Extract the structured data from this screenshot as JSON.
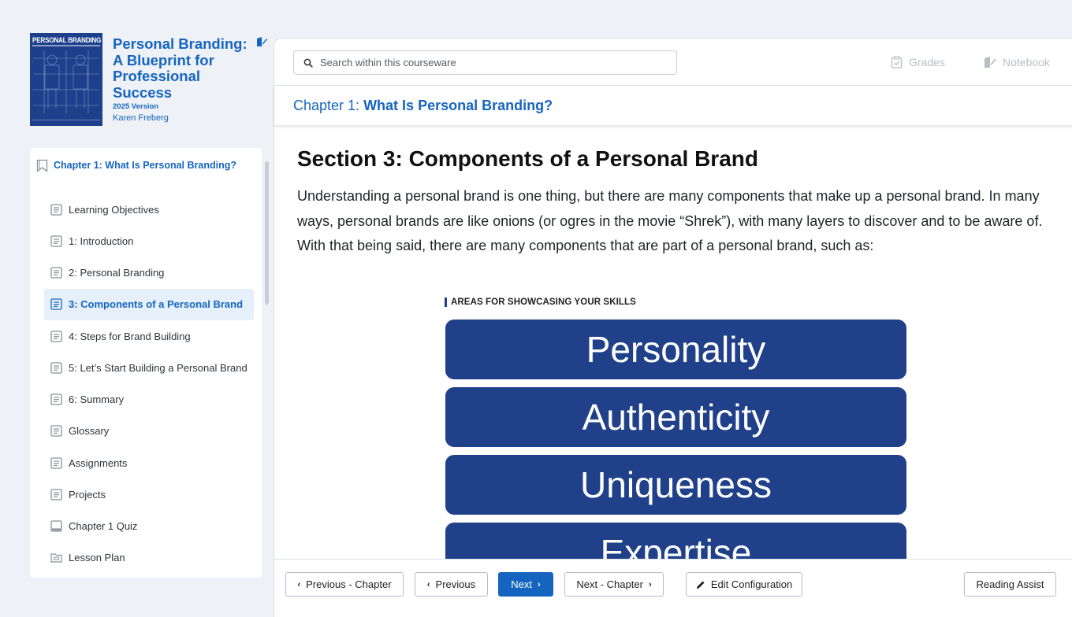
{
  "book": {
    "cover_title": "PERSONAL BRANDING",
    "title": "Personal Branding: A Blueprint for Professional Success",
    "version": "2025 Version",
    "author": "Karen Freberg"
  },
  "toc": {
    "chapter_label": "Chapter 1: What Is Personal Branding?",
    "items": [
      {
        "label": "Learning Objectives",
        "icon": "page-icon"
      },
      {
        "label": "1: Introduction",
        "icon": "page-icon"
      },
      {
        "label": "2: Personal Branding",
        "icon": "page-icon"
      },
      {
        "label": "3: Components of a Personal Brand",
        "icon": "page-icon",
        "active": true
      },
      {
        "label": "4: Steps for Brand Building",
        "icon": "page-icon"
      },
      {
        "label": "5: Let’s Start Building a Personal Brand",
        "icon": "page-icon"
      },
      {
        "label": "6: Summary",
        "icon": "page-icon"
      },
      {
        "label": "Glossary",
        "icon": "page-icon"
      },
      {
        "label": "Assignments",
        "icon": "page-icon"
      },
      {
        "label": "Projects",
        "icon": "page-icon"
      },
      {
        "label": "Chapter 1 Quiz",
        "icon": "quiz-icon"
      },
      {
        "label": "Lesson Plan",
        "icon": "folder-icon"
      }
    ]
  },
  "topbar": {
    "search_placeholder": "Search within this courseware",
    "grades_label": "Grades",
    "notebook_label": "Notebook"
  },
  "chapter_bar": {
    "prefix": "Chapter 1:",
    "title": "What Is Personal Branding?"
  },
  "content": {
    "section_title": "Section 3: Components of a Personal Brand",
    "paragraph": "Understanding a personal brand is one thing, but there are many components that make up a personal brand. In many ways, personal brands are like onions (or ogres in the movie “Shrek”), with many layers to discover and to be aware of. With that being said, there are many components that are part of a personal brand, such as:",
    "figure_label": "AREAS FOR SHOWCASING YOUR SKILLS",
    "figure_items": [
      "Personality",
      "Authenticity",
      "Uniqueness",
      "Expertise"
    ]
  },
  "footer": {
    "previous_chapter": "Previous - Chapter",
    "previous": "Previous",
    "next": "Next",
    "next_chapter": "Next - Chapter",
    "edit_configuration": "Edit Configuration",
    "reading_assist": "Reading Assist"
  },
  "colors": {
    "accent": "#1565c0",
    "pill": "#20418a",
    "active_bg": "#e6f0fb"
  }
}
